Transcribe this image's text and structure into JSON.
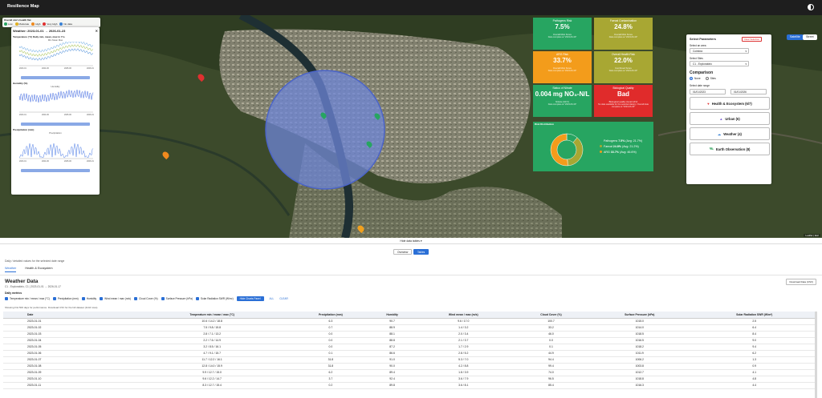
{
  "app": {
    "title": "Resilience Map"
  },
  "map": {
    "btn_satellite": "Satellite",
    "btn_street": "Street",
    "legend": {
      "title": "Overall site's health flat",
      "items": [
        {
          "label": "Low",
          "color": "#27a561"
        },
        {
          "label": "Moderate",
          "color": "#e0b020"
        },
        {
          "label": "High",
          "color": "#f08a1e"
        },
        {
          "label": "Very High",
          "color": "#e03030"
        },
        {
          "label": "No data",
          "color": "#3a82d6"
        }
      ]
    },
    "attribution": "Leaflet | Esri"
  },
  "weather_panel": {
    "title": "Weather: 2023-01-01 → 2026-01-23",
    "charts": [
      {
        "title": "Temperature (°C) Daily min, mean, max in Yrs",
        "legend": "Min   Mean   Max",
        "xticks": [
          "2023-01",
          "2024-06",
          "2025-06",
          "2026-01"
        ]
      },
      {
        "title": "Humidity (%)",
        "legend": "Humidity",
        "xticks": [
          "2023-01",
          "2024-06",
          "2025-06",
          "2026-01"
        ]
      },
      {
        "title": "Precipitation (mm)",
        "legend": "Precipitation",
        "xticks": [
          "2023-01",
          "2024-06",
          "2025-06",
          "2026-01"
        ]
      }
    ]
  },
  "kpis": [
    {
      "label": "Pathogens Risk",
      "value": "7.5%",
      "sub": "Overall Risk Score",
      "note": "Data complete at \"2023-06-30\"",
      "color": "#27a561"
    },
    {
      "label": "Faecal Contamination",
      "value": "24.8%",
      "sub": "Overall Risk Score",
      "note": "Data complete at \"2023-06-30\"",
      "color": "#a8a733"
    },
    {
      "label": "ARG Risk",
      "value": "33.7%",
      "sub": "Overall Risk Score",
      "note": "Data complete at \"2023-06-30\"",
      "color": "#f39c1b"
    },
    {
      "label": "Overall Health Risk",
      "value": "22.0%",
      "sub": "Combined Score",
      "note": "Data complete at \"2023-06-30\"",
      "color": "#a8a733"
    },
    {
      "label": "Status of Nitrate",
      "value": "0.004 mg NO₃-N/L",
      "sub": "Nitrate (GFV)",
      "note": "Data complete at \"2023-06-30\"",
      "color": "#27a561"
    },
    {
      "label": "Biological Quality",
      "value": "Bad",
      "sub": "Biological quality (local GFV)",
      "note": "No data available for the selected date(s). Overall data complete at \"2023-06-30\"",
      "color": "#e02b2b"
    }
  ],
  "risk_distribution": {
    "title": "Risk Distribution",
    "slices": [
      {
        "label": "Pathogens",
        "pct": "7.5%",
        "extra": "(Avg: 21.7%)",
        "value": 7.5,
        "color": "#27a561"
      },
      {
        "label": "Faecal",
        "pct": "24.8%",
        "extra": "(Avg: 21.2%)",
        "value": 24.8,
        "color": "#a8a733"
      },
      {
        "label": "ARG",
        "pct": "33.7%",
        "extra": "(Avg: 46.6%)",
        "value": 33.7,
        "color": "#f39c1b"
      }
    ]
  },
  "params": {
    "title": "Select Parameters",
    "clear": "Clear Selection",
    "area_label": "Select an area",
    "area_value": "Coimbra",
    "sites_label": "Select Sites",
    "sites_value": "C1 - Exploratório",
    "comparison": "Comparison",
    "opt_none": "None",
    "opt_sites": "Sites",
    "date_label": "Select date range",
    "date_from": "01/01/2023",
    "date_to": "01/01/2026",
    "categories": [
      {
        "label": "Health & Ecosystem (6/7)",
        "icon": "♥",
        "color": "#e03030"
      },
      {
        "label": "Urban (6)",
        "icon": "▲",
        "color": "#7a5fd6"
      },
      {
        "label": "Weather (4)",
        "icon": "☁",
        "color": "#3a82d6"
      },
      {
        "label": "Earth Observation (8)",
        "icon": "🛰",
        "color": "#2a9d56"
      }
    ]
  },
  "hide_tables": "Hide data tables",
  "view_toggle": {
    "a": "Overview",
    "b": "Tables"
  },
  "caption": "Daily / detailed values for the selected date range",
  "tabs": [
    "Weather",
    "Health & Ecosystem"
  ],
  "weather_data": {
    "title": "Weather Data",
    "subtitle": "C1 - Exploratório, C1 | 2023-01-01 → 2026-01-17",
    "download": "Download Data (CSV)",
    "metrics_label": "Daily metrics",
    "metrics": [
      "Temperature min / mean / max (°C)",
      "Precipitation (mm)",
      "Humidity",
      "Wind mean / max (m/s)",
      "Cloud Cover (%)",
      "Surface Pressure (hPa)",
      "Solar Radiation SWR (W/m²)"
    ],
    "hide_charts": "Hide Charts Panel",
    "all": "ALL",
    "clear": "CLEAR",
    "note": "Showing first 500 days for performance. Download CSV for the full dataset (1144 rows)."
  },
  "table": {
    "headers": [
      "Date",
      "Temperature min / mean / max (°C)",
      "Precipitation (mm)",
      "Humidity",
      "Wind mean / max (m/s)",
      "Cloud Cover (%)",
      "Surface Pressure (hPa)",
      "Solar Radiation SWR (W/m²)"
    ],
    "rows": [
      [
        "2023-01-01",
        "10.6 / 14.2 / 18.8",
        "6.3",
        "90.7",
        "9.6 / 17.0",
        "100.7",
        "1015.0",
        "2.5"
      ],
      [
        "2023-01-02",
        "7.5 / 9.8 / 15.8",
        "0.7",
        "88.9",
        "1.4 / 3.2",
        "33.2",
        "1014.0",
        "6.4"
      ],
      [
        "2023-01-03",
        "2.8 / 7.1 / 13.2",
        "0.0",
        "88.1",
        "2.0 / 3.4",
        "46.0",
        "1018.5",
        "8.4"
      ],
      [
        "2023-01-04",
        "2.2 / 7.6 / 14.9",
        "0.0",
        "88.8",
        "2.1 / 3.7",
        "0.0",
        "1016.5",
        "9.0"
      ],
      [
        "2023-01-05",
        "3.2 / 8.5 / 16.1",
        "0.0",
        "87.2",
        "1.7 / 2.9",
        "0.1",
        "1018.2",
        "9.4"
      ],
      [
        "2023-01-06",
        "4.7 / 9.1 / 15.7",
        "0.1",
        "86.6",
        "2.8 / 5.2",
        "44.9",
        "1011.9",
        "6.2"
      ],
      [
        "2023-01-07",
        "11.7 / 12.2 / 16.1",
        "31.8",
        "91.0",
        "5.3 / 7.0",
        "94.4",
        "1006.2",
        "1.3"
      ],
      [
        "2023-01-08",
        "12.8 / 14.0 / 15.9",
        "31.8",
        "90.0",
        "4.2 / 8.8",
        "99.4",
        "1003.8",
        "0.9"
      ],
      [
        "2023-01-09",
        "9.9 / 12.7 / 15.0",
        "6.2",
        "89.4",
        "1.8 / 3.9",
        "74.0",
        "1012.7",
        "4.1"
      ],
      [
        "2023-01-10",
        "9.6 / 12.2 / 14.7",
        "3.7",
        "92.4",
        "3.6 / 7.9",
        "96.5",
        "1018.8",
        "4.8"
      ],
      [
        "2023-01-11",
        "8.3 / 12.7 / 15.4",
        "0.2",
        "89.8",
        "3.6 / 8.1",
        "85.4",
        "1016.3",
        "4.4"
      ]
    ]
  }
}
